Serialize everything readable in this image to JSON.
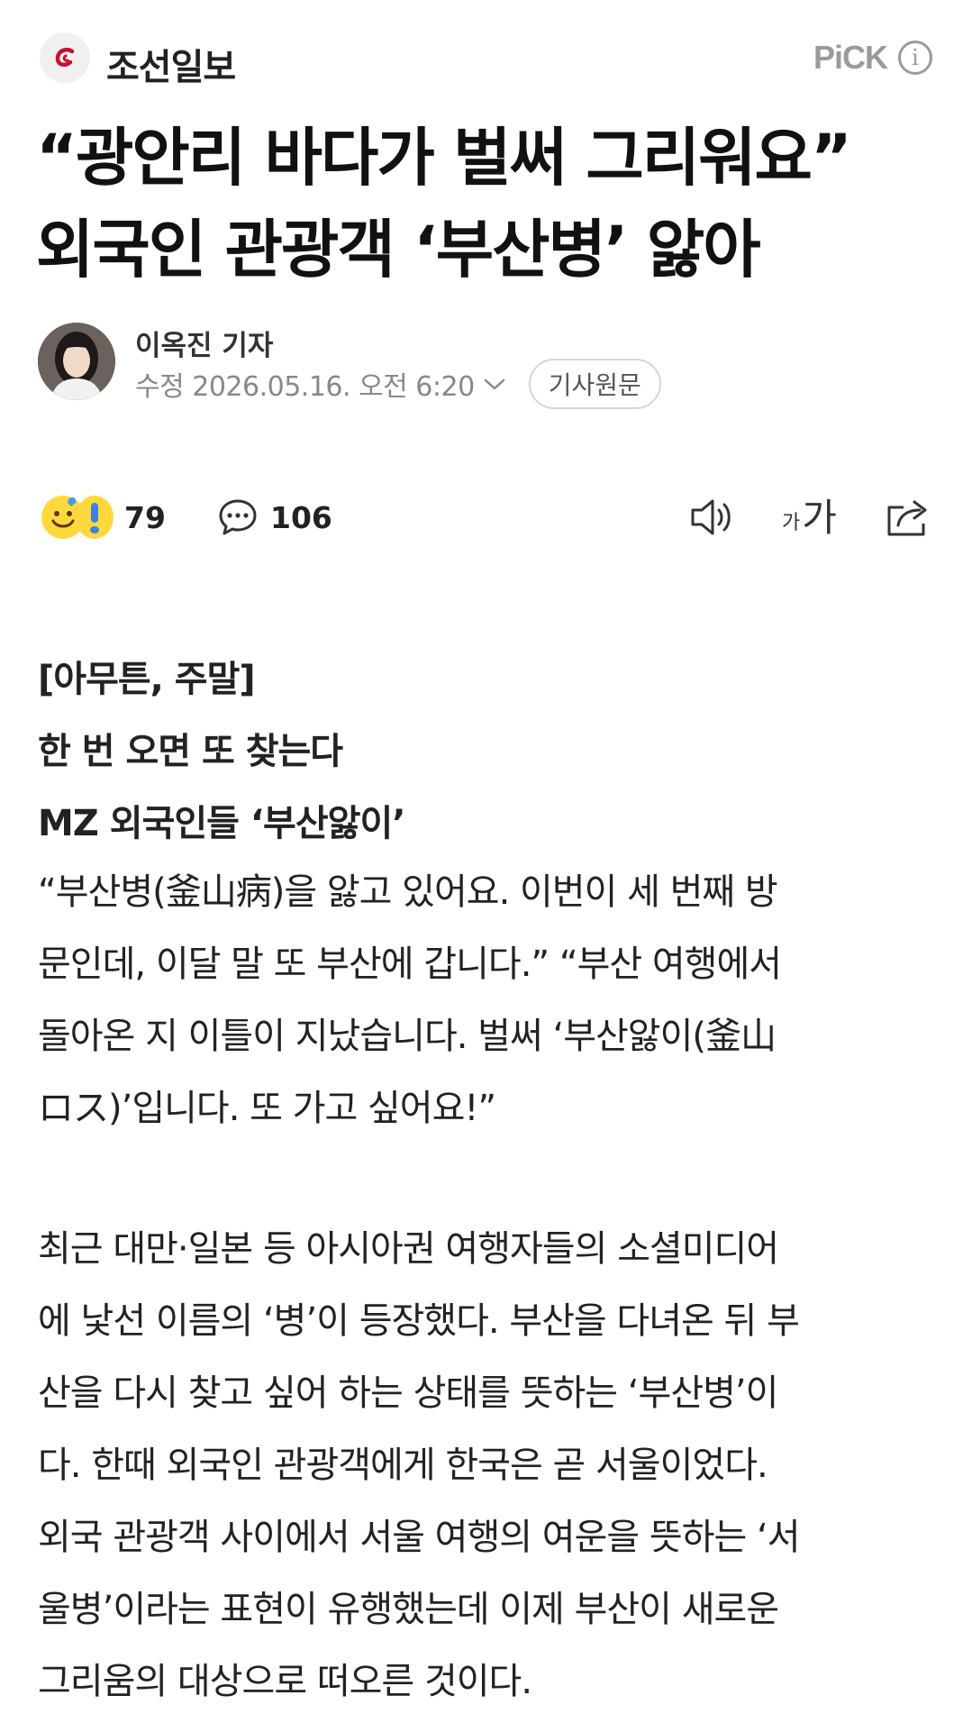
{
  "header": {
    "press_name": "조선일보",
    "pick_label": "PiCK",
    "info_glyph": "i"
  },
  "headline": {
    "lines": [
      "“광안리 바다가 벌써 그리워요”",
      "외국인 관광객 ‘부산병’ 앓아"
    ]
  },
  "byline": {
    "reporter": "이옥진 기자",
    "date": "수정 2026.05.16. 오전 6:20",
    "original_button": "기사원문"
  },
  "actions": {
    "reaction_count": "79",
    "comment_count": "106",
    "font_small": "가",
    "font_large": "가"
  },
  "article": {
    "subheads": [
      "[아무튼, 주말]",
      "한 번 오면 또 찾는다",
      "MZ 외국인들 ‘부산앓이’"
    ],
    "paragraph1": [
      "“부산병(釜山病)을 앓고 있어요. 이번이 세 번째 방",
      "문인데, 이달 말 또 부산에 갑니다.” “부산 여행에서",
      "돌아온 지 이틀이 지났습니다. 벌써 ‘부산앓이(釜山",
      "ロス)’입니다. 또 가고 싶어요!”"
    ],
    "paragraph2": [
      "최근 대만·일본 등 아시아권 여행자들의 소셜미디어",
      "에 낯선 이름의 ‘병’이 등장했다. 부산을 다녀온 뒤 부",
      "산을 다시 찾고 싶어 하는 상태를 뜻하는 ‘부산병’이",
      "다. 한때 외국인 관광객에게 한국은 곧 서울이었다.",
      "외국 관광객 사이에서 서울 여행의 여운을 뜻하는 ‘서",
      "울병’이라는 표현이 유행했는데 이제 부산이 새로운",
      "그리움의 대상으로 떠오른 것이다."
    ]
  },
  "colors": {
    "brand_red": "#c8102e",
    "muted_gray": "#888888",
    "text": "#222222"
  },
  "icons": [
    "press-logo-icon",
    "info-icon",
    "chevron-down-icon",
    "smile-emoji-icon",
    "surprise-emoji-icon",
    "comment-icon",
    "speaker-icon",
    "share-icon"
  ]
}
